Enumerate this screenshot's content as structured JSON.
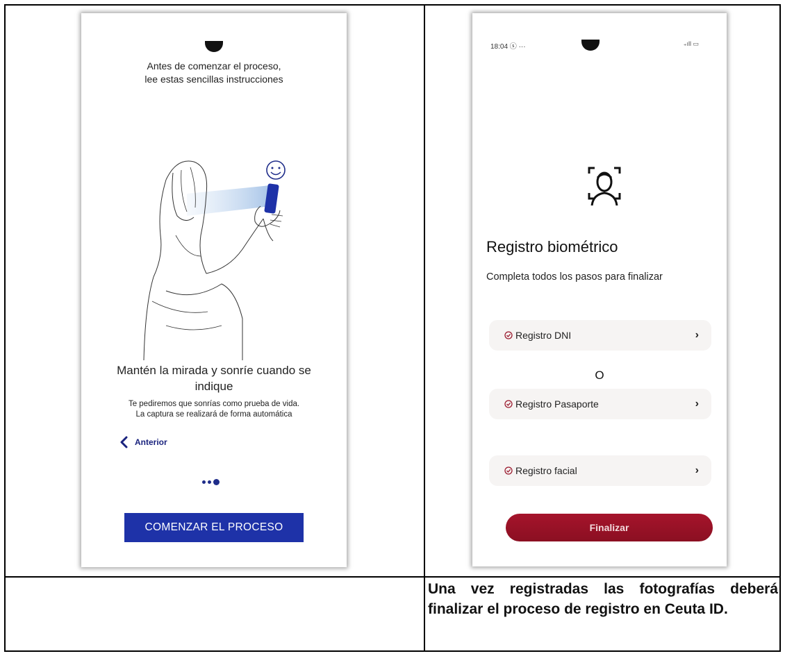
{
  "left_screen": {
    "intro_line1": "Antes de comenzar el proceso,",
    "intro_line2": "lee estas sencillas instrucciones",
    "illustration_icon": "woman-selfie-smile-illustration",
    "headline_line1": "Mantén la mirada y sonríe cuando se",
    "headline_line2": "indique",
    "subtext_line1": "Te pediremos que sonrías como prueba de vida.",
    "subtext_line2": "La captura se realizará de forma automática",
    "back_label": "Anterior",
    "pager": {
      "pages": 3,
      "current": 3
    },
    "cta_label": "COMENZAR EL PROCESO",
    "cta_color": "#1e32a8"
  },
  "right_screen": {
    "status_time": "18:04 ⓢ ···",
    "status_right": "₊ıll ▭",
    "face_icon": "face-scan-icon",
    "title": "Registro biométrico",
    "subtitle": "Completa todos los pasos para finalizar",
    "items": [
      {
        "label": "Registro DNI"
      },
      {
        "label": "Registro Pasaporte"
      },
      {
        "label": "Registro facial"
      }
    ],
    "separator": "O",
    "finish_label": "Finalizar",
    "finish_color": "#a5142b"
  },
  "caption": "Una vez registradas las fotografías deberá finalizar el proceso de registro en Ceuta ID."
}
